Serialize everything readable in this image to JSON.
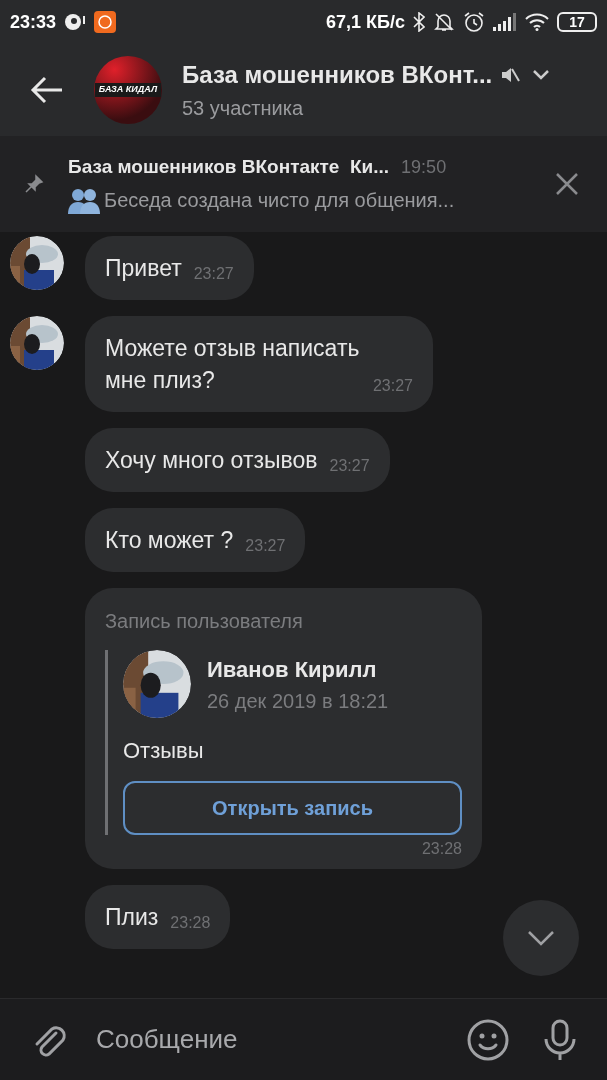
{
  "status_bar": {
    "time": "23:33",
    "speed": "67,1 КБ/с",
    "battery": "17"
  },
  "header": {
    "avatar_text": "БАЗА КИДАЛ",
    "title": "База мошенников ВКонт...",
    "subtitle": "53 участника",
    "muted": true
  },
  "pinned": {
    "title": "База мошенников ВКонтакте  Ки...",
    "time": "19:50",
    "text": "Беседа создана чисто для общения..."
  },
  "messages": [
    {
      "kind": "text",
      "avatar": true,
      "text": "Привет",
      "time": "23:27"
    },
    {
      "kind": "text",
      "avatar": true,
      "text": "Можете отзыв написать мне плиз?",
      "time": "23:27"
    },
    {
      "kind": "text",
      "avatar": false,
      "text": "Хочу много отзывов",
      "time": "23:27"
    },
    {
      "kind": "text",
      "avatar": false,
      "text": "Кто может ?",
      "time": "23:27"
    },
    {
      "kind": "post",
      "avatar": false,
      "label": "Запись пользователя",
      "author": "Иванов Кирилл",
      "date": "26 дек 2019 в 18:21",
      "text": "Отзывы",
      "button": "Открыть запись",
      "time": "23:28"
    },
    {
      "kind": "text",
      "avatar": false,
      "text": "Плиз",
      "time": "23:28"
    }
  ],
  "composer": {
    "placeholder": "Сообщение"
  }
}
